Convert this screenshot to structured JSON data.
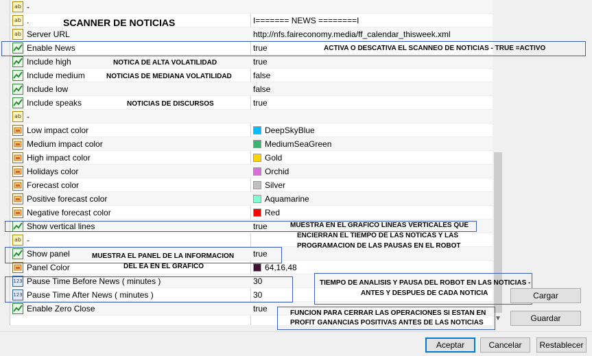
{
  "rows": [
    {
      "icon": "ab",
      "name": "-",
      "value": "",
      "alt": true
    },
    {
      "icon": "ab",
      "name": ".",
      "value": "I======= NEWS ========I",
      "alt": false
    },
    {
      "icon": "ab",
      "name": "Server URL",
      "value": "http://nfs.faireconomy.media/ff_calendar_thisweek.xml",
      "alt": true
    },
    {
      "icon": "bool",
      "name": "Enable News",
      "value": "true",
      "alt": false
    },
    {
      "icon": "bool",
      "name": "Include high",
      "value": "true",
      "alt": true
    },
    {
      "icon": "bool",
      "name": "Include medium",
      "value": "false",
      "alt": false
    },
    {
      "icon": "bool",
      "name": "Include low",
      "value": "false",
      "alt": true
    },
    {
      "icon": "bool",
      "name": "Include speaks",
      "value": "true",
      "alt": false
    },
    {
      "icon": "ab",
      "name": "-",
      "value": "",
      "alt": true
    },
    {
      "icon": "color",
      "name": "Low impact color",
      "value": "DeepSkyBlue",
      "swatch": "#00bfff",
      "alt": false
    },
    {
      "icon": "color",
      "name": "Medium impact color",
      "value": "MediumSeaGreen",
      "swatch": "#3cb371",
      "alt": true
    },
    {
      "icon": "color",
      "name": "High impact color",
      "value": "Gold",
      "swatch": "#ffd700",
      "alt": false
    },
    {
      "icon": "color",
      "name": "Holidays color",
      "value": "Orchid",
      "swatch": "#da70d6",
      "alt": true
    },
    {
      "icon": "color",
      "name": "Forecast color",
      "value": "Silver",
      "swatch": "#c0c0c0",
      "alt": false
    },
    {
      "icon": "color",
      "name": "Positive forecast color",
      "value": "Aquamarine",
      "swatch": "#7fffd4",
      "alt": true
    },
    {
      "icon": "color",
      "name": "Negative forecast color",
      "value": "Red",
      "swatch": "#ff0000",
      "alt": false
    },
    {
      "icon": "bool",
      "name": "Show vertical lines",
      "value": "true",
      "alt": true
    },
    {
      "icon": "ab",
      "name": "-",
      "value": "",
      "alt": false
    },
    {
      "icon": "bool",
      "name": "Show panel",
      "value": "true",
      "alt": true
    },
    {
      "icon": "color",
      "name": "Panel Color",
      "value": "64,16,48",
      "swatch": "#401030",
      "alt": false
    },
    {
      "icon": "num",
      "name": "Pause Time Before News ( minutes )",
      "value": "30",
      "alt": true
    },
    {
      "icon": "num",
      "name": "Pause Time After News  ( minutes )",
      "value": "30",
      "alt": false
    },
    {
      "icon": "bool",
      "name": "Enable Zero Close",
      "value": "true",
      "alt": true
    }
  ],
  "annotations": {
    "scanner_title": "SCANNER DE NOTICIAS",
    "enable_news": "ACTIVA O DESCATIVA EL SCANNEO DE NOTICIAS - TRUE =ACTIVO",
    "include_high": "NOTICA DE ALTA VOLATILIDAD",
    "include_medium": "NOTICIAS DE MEDIANA VOLATILIDAD",
    "include_speaks": "NOTICIAS DE DISCURSOS",
    "vertical_lines_1": "MUESTRA EN EL GRAFICO LINEAS VERTICALES QUE",
    "vertical_lines_2": "ENCIERRAN EL TIEMPO DE LAS NOTICAS Y LAS",
    "vertical_lines_3": "PROGRAMACION DE LAS PAUSAS EN EL ROBOT",
    "show_panel_1": "MUESTRA EL PANEL DE LA INFORMACION",
    "show_panel_2": "DEL EA EN EL GRAFICO",
    "pause_1": "TIEMPO DE ANALISIS Y PAUSA DEL ROBOT EN LAS NOTICIAS -",
    "pause_2": "ANTES Y DESPUES DE CADA NOTICIA",
    "zero_close_1": "FUNCION PARA CERRAR LAS OPERACIONES SI ESTAN EN",
    "zero_close_2": "PROFIT GANANCIAS POSITIVAS ANTES DE LAS NOTICIAS"
  },
  "icons": {
    "ab": "ab",
    "num": "123",
    "scroll_down": "▼"
  },
  "buttons": {
    "load": "Cargar",
    "save": "Guardar",
    "accept": "Aceptar",
    "cancel": "Cancelar",
    "reset": "Restablecer"
  }
}
